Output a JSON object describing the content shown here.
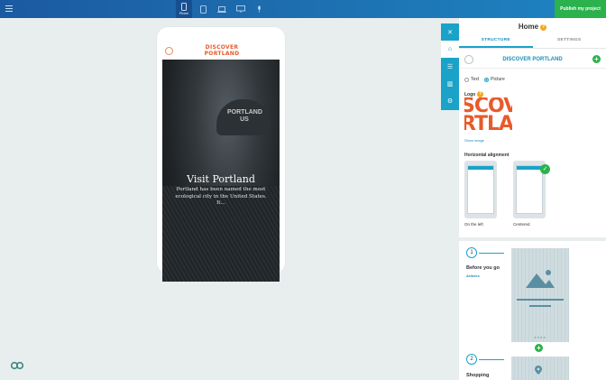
{
  "topbar": {
    "devices": [
      {
        "name": "phone",
        "label": "Phone",
        "active": true
      },
      {
        "name": "tablet",
        "label": "",
        "active": false
      },
      {
        "name": "laptop",
        "label": "",
        "active": false
      },
      {
        "name": "desktop",
        "label": "",
        "active": false
      },
      {
        "name": "microphone",
        "label": "",
        "active": false
      }
    ],
    "publish_label": "Publish my project"
  },
  "phone": {
    "logo_line1": "DISCOVER",
    "logo_line2": "PORTLAND",
    "cap_line1": "PORTLAND",
    "cap_line2": "US",
    "hero_title": "Visit Portland",
    "hero_desc": "Portland has been named the most ecological city in the United States. It..."
  },
  "rail": {
    "items": [
      {
        "icon": "close-icon",
        "glyph": "✕",
        "active": false
      },
      {
        "icon": "home-icon",
        "glyph": "⌂",
        "active": true
      },
      {
        "icon": "list-icon",
        "glyph": "☰",
        "active": false
      },
      {
        "icon": "stats-icon",
        "glyph": "▥",
        "active": false
      },
      {
        "icon": "gear-icon",
        "glyph": "⚙",
        "active": false
      }
    ]
  },
  "panel": {
    "title": "Home",
    "help": "?",
    "tabs": [
      {
        "label": "STRUCTURE",
        "active": true
      },
      {
        "label": "SETTINGS",
        "active": false
      }
    ],
    "section_name": "DISCOVER PORTLAND",
    "logo_type_options": [
      {
        "label": "Text",
        "selected": false
      },
      {
        "label": "Picture",
        "selected": true
      }
    ],
    "logo_label": "Logo",
    "logo_preview_text_1": "SCOV",
    "logo_preview_text_2": "RTLAN",
    "show_image": "Show image",
    "alignment_label": "Horizontal alignment",
    "alignment_options": [
      {
        "label": "On the left",
        "bar_text": "Logo",
        "selected": false
      },
      {
        "label": "Centered",
        "bar_text": "Logo",
        "selected": true
      }
    ],
    "sections": [
      {
        "number": "1",
        "title": "Before you go",
        "subtitle": "Articles"
      },
      {
        "number": "2",
        "title": "Shopping",
        "subtitle": ""
      }
    ],
    "carousel_dots": "●●●●"
  },
  "colors": {
    "accent": "#1aa2c8",
    "publish": "#2bb24c",
    "brand_orange": "#e85a2c"
  }
}
